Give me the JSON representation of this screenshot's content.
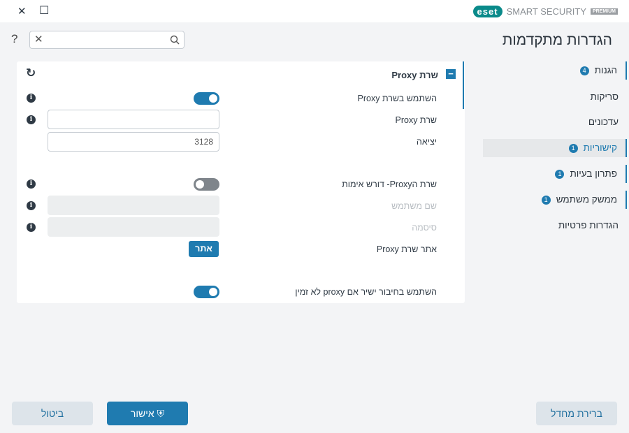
{
  "window": {
    "close": "✕",
    "maximize": "☐"
  },
  "brand": {
    "logo": "eset",
    "product": "SMART SECURITY",
    "edition": "PREMIUM"
  },
  "header": {
    "title": "הגדרות מתקדמות",
    "help": "?",
    "search_placeholder": ""
  },
  "sidebar": {
    "items": [
      {
        "label": "הגנות",
        "badge": "4"
      },
      {
        "label": "סריקות"
      },
      {
        "label": "עדכונים"
      },
      {
        "label": "קישוריות",
        "badge": "1"
      },
      {
        "label": "פתרון בעיות",
        "badge": "1"
      },
      {
        "label": "ממשק משתמש",
        "badge": "1"
      },
      {
        "label": "הגדרות פרטיות"
      }
    ]
  },
  "section": {
    "title": "שרת Proxy",
    "collapse": "−",
    "revert": "↻"
  },
  "rows": {
    "use_proxy": {
      "label": "השתמש בשרת Proxy",
      "on": true
    },
    "proxy_server": {
      "label": "שרת Proxy",
      "value": ""
    },
    "port": {
      "label": "יציאה",
      "value": "3128"
    },
    "auth": {
      "label": "שרת הProxy- דורש אימות",
      "on": false
    },
    "username": {
      "label": "שם משתמש",
      "value": ""
    },
    "password": {
      "label": "סיסמה",
      "value": ""
    },
    "detect": {
      "label": "אתר שרת Proxy",
      "button": "אתר"
    },
    "direct": {
      "label": "השתמש בחיבור ישיר אם proxy לא זמין",
      "on": true
    }
  },
  "footer": {
    "default": "ברירת מחדל",
    "ok": "אישור",
    "cancel": "ביטול"
  }
}
